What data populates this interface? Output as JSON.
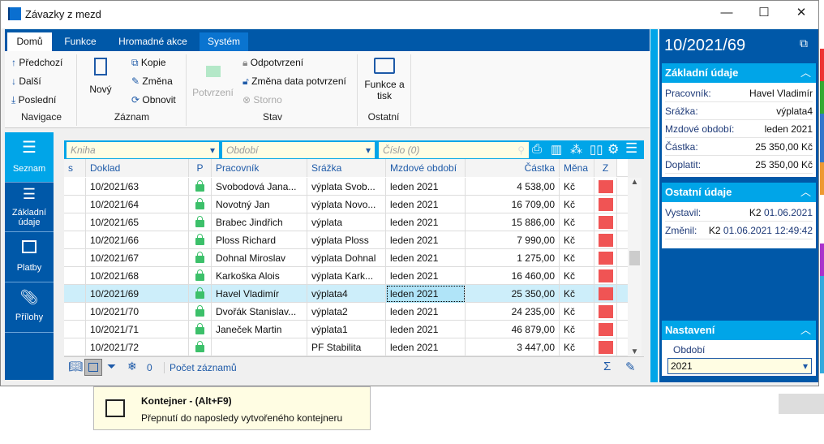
{
  "window": {
    "title": "Závazky z mezd",
    "minimize": "—",
    "maximize": "☐",
    "close": "✕"
  },
  "tabs": [
    {
      "label": "Domů"
    },
    {
      "label": "Funkce"
    },
    {
      "label": "Hromadné akce"
    },
    {
      "label": "Systém"
    }
  ],
  "ribbon": {
    "navigace": {
      "label": "Navigace",
      "prev": "Předchozí",
      "next": "Další",
      "last": "Poslední"
    },
    "zaznam": {
      "label": "Záznam",
      "new": "Nový",
      "copy": "Kopie",
      "change": "Změna",
      "refresh": "Obnovit"
    },
    "stav": {
      "label": "Stav",
      "confirm": "Potvrzení",
      "unconfirm": "Odpotvrzení",
      "change_date": "Změna data potvrzení",
      "storno": "Storno"
    },
    "ostatni": {
      "label": "Ostatní",
      "print1": "Funkce a",
      "print2": "tisk"
    }
  },
  "leftnav": [
    {
      "label": "Seznam"
    },
    {
      "label": "Základní"
    },
    {
      "label": "údaje"
    },
    {
      "label": "Platby"
    },
    {
      "label": "Přílohy"
    }
  ],
  "filter": {
    "kniha": "Kniha",
    "obdobi": "Období",
    "cislo": "Číslo (0)"
  },
  "columns": [
    "s",
    "Doklad",
    "P",
    "Pracovník",
    "Srážka",
    "Mzdové období",
    "Částka",
    "Měna",
    "Z"
  ],
  "rows": [
    [
      "10/2021/63",
      "Svobodová Jana...",
      "výplata Svob...",
      "leden 2021",
      "4 538,00",
      "Kč"
    ],
    [
      "10/2021/64",
      "Novotný Jan",
      "výplata Novo...",
      "leden 2021",
      "16 709,00",
      "Kč"
    ],
    [
      "10/2021/65",
      "Brabec Jindřich",
      "výplata",
      "leden 2021",
      "15 886,00",
      "Kč"
    ],
    [
      "10/2021/66",
      "Ploss Richard",
      "výplata Ploss",
      "leden 2021",
      "7 990,00",
      "Kč"
    ],
    [
      "10/2021/67",
      "Dohnal Miroslav",
      "výplata Dohnal",
      "leden 2021",
      "1 275,00",
      "Kč"
    ],
    [
      "10/2021/68",
      "Karkoška Alois",
      "výplata Kark...",
      "leden 2021",
      "16 460,00",
      "Kč"
    ],
    [
      "10/2021/69",
      "Havel Vladimír",
      "výplata4",
      "leden 2021",
      "25 350,00",
      "Kč"
    ],
    [
      "10/2021/70",
      "Dvořák Stanislav...",
      "výplata2",
      "leden 2021",
      "24 235,00",
      "Kč"
    ],
    [
      "10/2021/71",
      "Janeček Martin",
      "výplata1",
      "leden 2021",
      "46 879,00",
      "Kč"
    ],
    [
      "10/2021/72",
      "",
      "PF Stabilita",
      "leden 2021",
      "3 447,00",
      "Kč"
    ]
  ],
  "selected_row": 6,
  "footer": {
    "filter_count": "0",
    "record_count": "Počet záznamů"
  },
  "right": {
    "title": "10/2021/69",
    "basic": {
      "label": "Základní údaje",
      "items": [
        [
          "Pracovník:",
          "Havel Vladimír"
        ],
        [
          "Srážka:",
          "výplata4"
        ],
        [
          "Mzdové období:",
          "leden 2021"
        ],
        [
          "Částka:",
          "25 350,00 Kč"
        ],
        [
          "Doplatit:",
          "25 350,00 Kč"
        ]
      ]
    },
    "other": {
      "label": "Ostatní údaje",
      "items": [
        [
          "Vystavil:",
          "K2",
          "01.06.2021"
        ],
        [
          "Změnil:",
          "K2",
          "01.06.2021 12:49:42"
        ]
      ]
    },
    "settings": {
      "label": "Nastavení",
      "field_label": "Období",
      "field_value": "2021"
    }
  },
  "tooltip": {
    "title": "Kontejner - (Alt+F9)",
    "text": "Přepnutí do naposledy vytvořeného kontejneru"
  },
  "colors": {
    "brand": "#0058a8",
    "accent": "#00a5e8",
    "status_red": "#f05454",
    "lock_green": "#3cc06a"
  }
}
